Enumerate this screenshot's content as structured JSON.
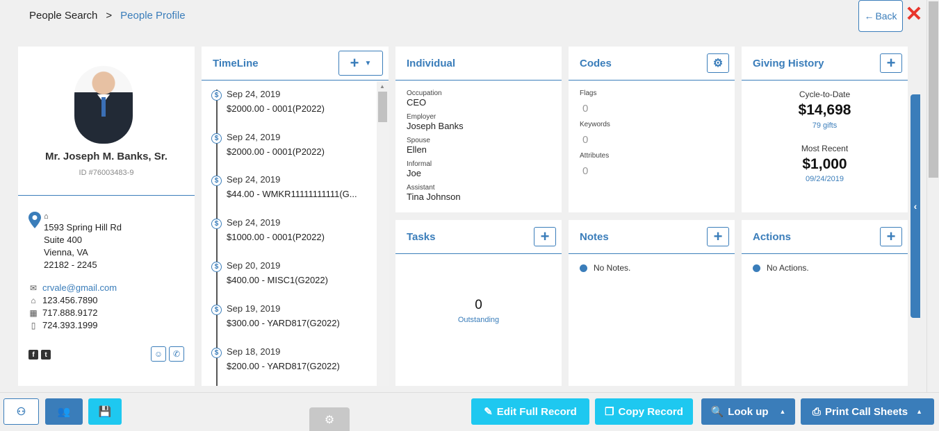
{
  "breadcrumb": {
    "root": "People Search",
    "sep": ">",
    "current": "People Profile"
  },
  "header": {
    "back_label": "Back",
    "close_glyph": "✕"
  },
  "profile": {
    "name": "Mr. Joseph M. Banks, Sr.",
    "id": "ID #76003483-9",
    "address": [
      "1593 Spring Hill Rd",
      "Suite 400",
      "Vienna, VA",
      "22182 - 2245"
    ],
    "email": "crvale@gmail.com",
    "home_phone": "123.456.7890",
    "work_phone": "717.888.9172",
    "mobile_phone": "724.393.1999"
  },
  "timeline": {
    "title": "TimeLine",
    "items": [
      {
        "date": "Sep 24, 2019",
        "amount": "$2000.00 - 0001(P2022)"
      },
      {
        "date": "Sep 24, 2019",
        "amount": "$2000.00 - 0001(P2022)"
      },
      {
        "date": "Sep 24, 2019",
        "amount": "$44.00 - WMKR11111111111(G..."
      },
      {
        "date": "Sep 24, 2019",
        "amount": "$1000.00 - 0001(P2022)"
      },
      {
        "date": "Sep 20, 2019",
        "amount": "$400.00 - MISC1(G2022)"
      },
      {
        "date": "Sep 19, 2019",
        "amount": "$300.00 - YARD817(G2022)"
      },
      {
        "date": "Sep 18, 2019",
        "amount": "$200.00 - YARD817(G2022)"
      }
    ]
  },
  "individual": {
    "title": "Individual",
    "fields": [
      {
        "label": "Occupation",
        "value": "CEO"
      },
      {
        "label": "Employer",
        "value": "Joseph Banks"
      },
      {
        "label": "Spouse",
        "value": "Ellen"
      },
      {
        "label": "Informal",
        "value": "Joe"
      },
      {
        "label": "Assistant",
        "value": "Tina Johnson"
      }
    ]
  },
  "codes": {
    "title": "Codes",
    "flags_label": "Flags",
    "flags_value": "0",
    "keywords_label": "Keywords",
    "keywords_value": "0",
    "attributes_label": "Attributes",
    "attributes_value": "0"
  },
  "giving": {
    "title": "Giving History",
    "ctd_label": "Cycle-to-Date",
    "ctd_amount": "$14,698",
    "ctd_gifts": "79 gifts",
    "recent_label": "Most Recent",
    "recent_amount": "$1,000",
    "recent_date": "09/24/2019"
  },
  "tasks": {
    "title": "Tasks",
    "count": "0",
    "count_label": "Outstanding"
  },
  "notes": {
    "title": "Notes",
    "empty": "No Notes."
  },
  "actions": {
    "title": "Actions",
    "empty": "No Actions."
  },
  "toolbar": {
    "edit_label": "Edit Full Record",
    "copy_label": "Copy Record",
    "lookup_label": "Look up",
    "print_label": "Print Call Sheets"
  },
  "colors": {
    "accent": "#3a7dba",
    "cyan": "#1ec8f0",
    "close": "#e8352b"
  }
}
